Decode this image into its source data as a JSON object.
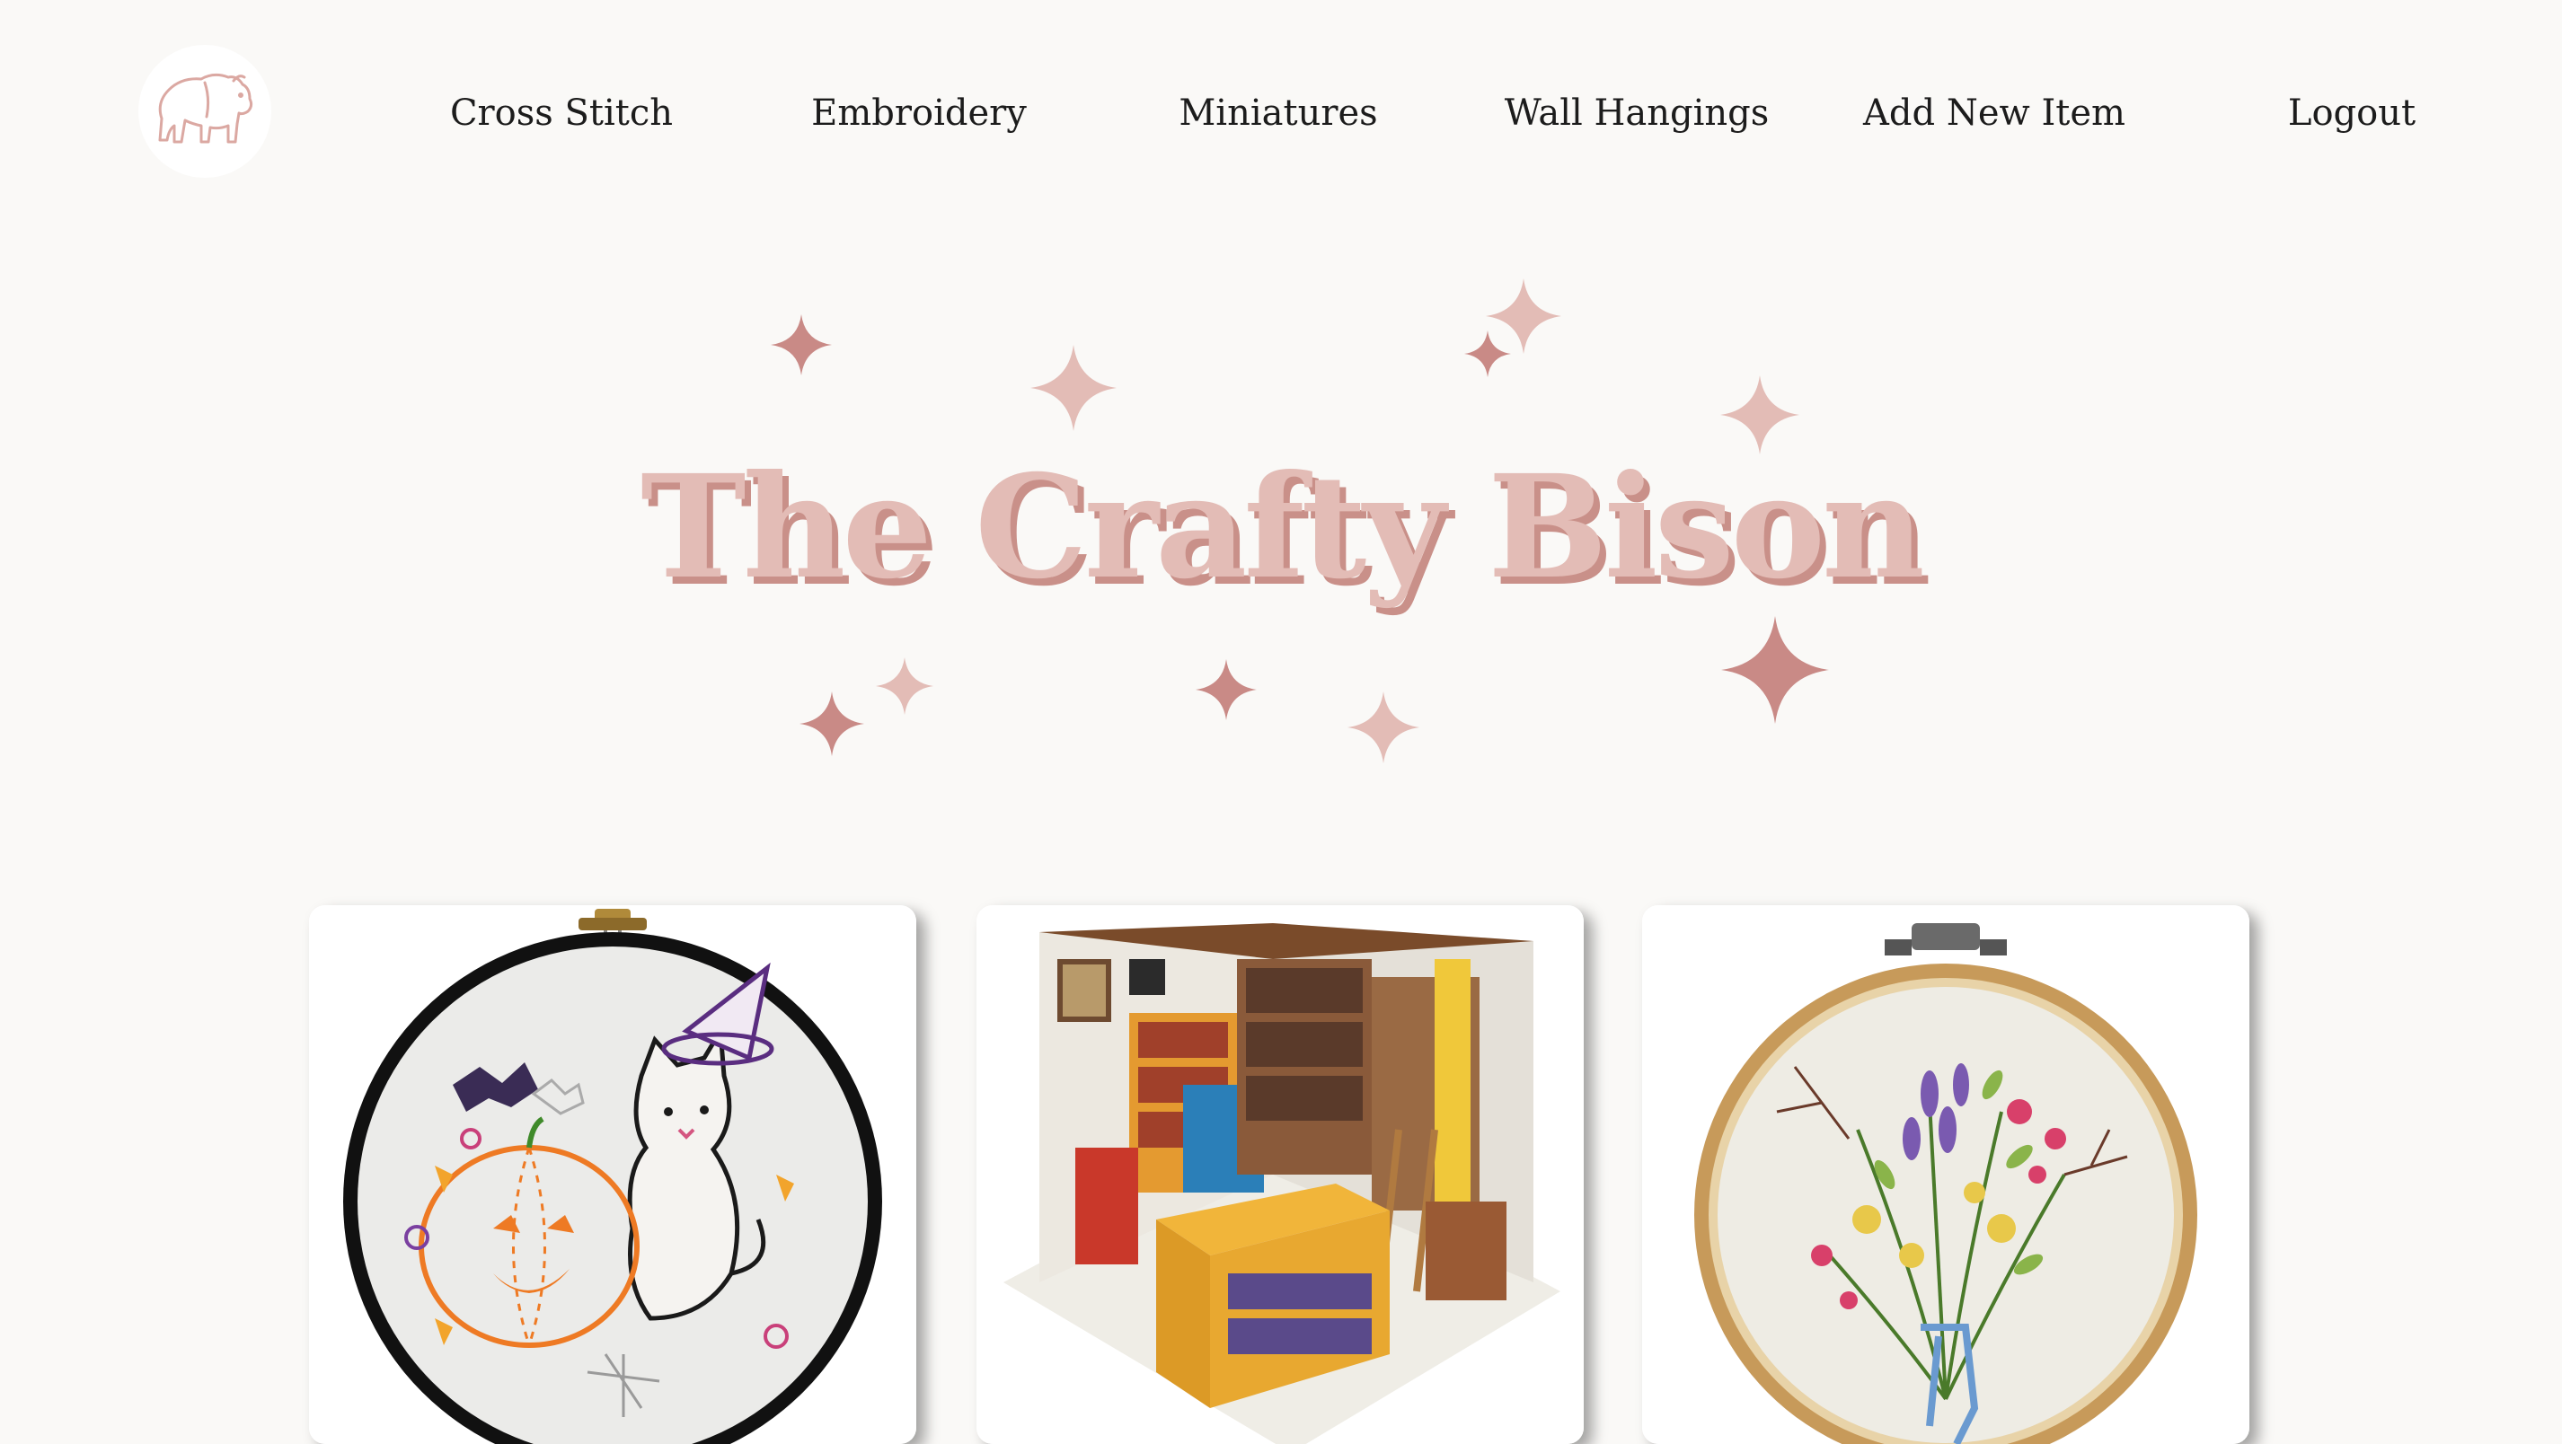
{
  "brand": {
    "logo_icon": "bison-logo-icon"
  },
  "nav": {
    "items": [
      {
        "label": "Cross Stitch"
      },
      {
        "label": "Embroidery"
      },
      {
        "label": "Miniatures"
      },
      {
        "label": "Wall Hangings"
      },
      {
        "label": "Add New Item"
      },
      {
        "label": "Logout"
      }
    ]
  },
  "hero": {
    "title": "The Crafty Bison",
    "decoration_icon": "sparkle-icon"
  },
  "colors": {
    "background": "#faf9f7",
    "title_fill": "#e3bcb6",
    "title_shadow": "#c99089",
    "sparkle_light": "#e3bcb6",
    "sparkle_dark": "#c98a86",
    "nav_text": "#1c1c1c"
  },
  "products": [
    {
      "icon": "halloween-embroidery-hoop-image"
    },
    {
      "icon": "miniature-bookshop-image"
    },
    {
      "icon": "floral-embroidery-hoop-image"
    }
  ]
}
